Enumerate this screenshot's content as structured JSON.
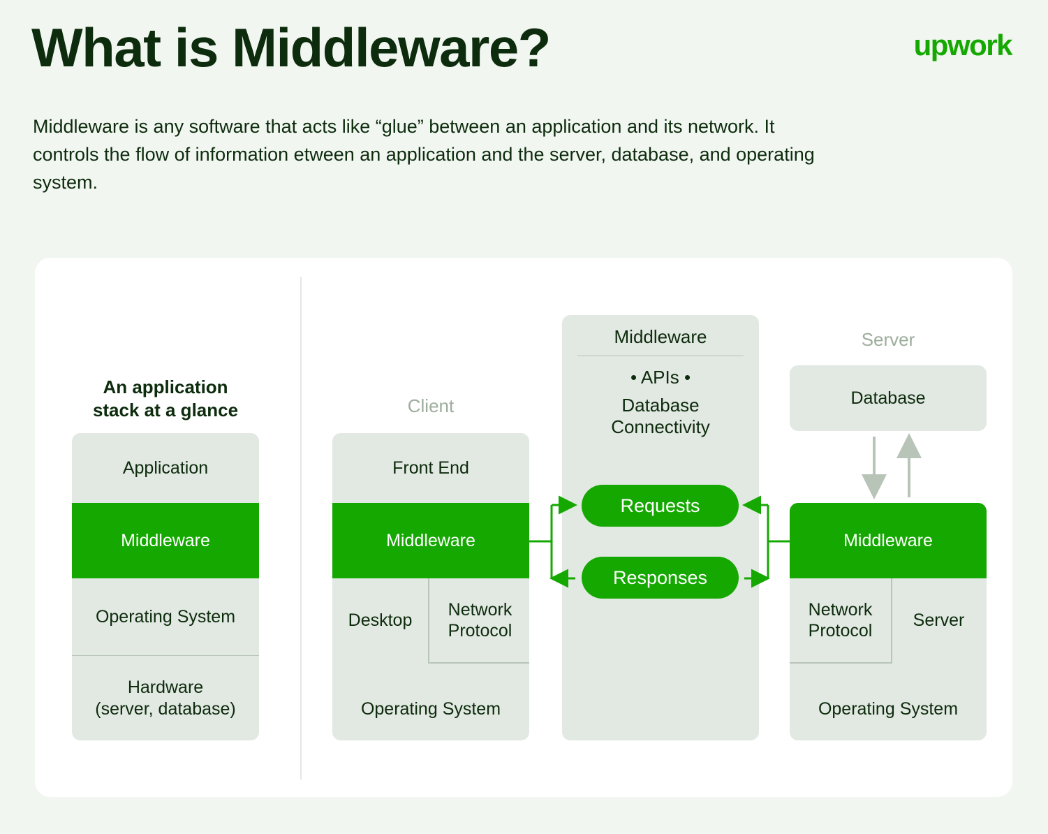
{
  "header": {
    "title": "What is Middleware?",
    "logo": "upwork",
    "intro": "Middleware is any software that acts like “glue” between an application and its network. It controls the flow of information etween an application and the server, database, and operating system."
  },
  "colors": {
    "background": "#f1f6f1",
    "card": "#ffffff",
    "green": "#14a800",
    "box_gray": "#e2e8e2",
    "muted_label": "#9dad9c",
    "text_dark": "#0d2b0d",
    "rule": "#b9c5b8",
    "arrow_gray": "#b8c4b8"
  },
  "columns": {
    "stack": {
      "heading": "An application\nstack at a glance",
      "heading_line1": "An application",
      "heading_line2": "stack at a glance",
      "rows": [
        {
          "label": "Application",
          "highlight": false
        },
        {
          "label": "Middleware",
          "highlight": true
        },
        {
          "label": "Operating System",
          "highlight": false
        },
        {
          "label": "Hardware\n(server, database)",
          "highlight": false
        }
      ],
      "hardware_line1": "Hardware",
      "hardware_line2": "(server, database)"
    },
    "client": {
      "heading": "Client",
      "rows": [
        {
          "label": "Front End",
          "highlight": false
        },
        {
          "label": "Middleware",
          "highlight": true
        },
        {
          "label": "Operating System",
          "highlight": false
        }
      ],
      "desktop": "Desktop",
      "network_protocol_line1": "Network",
      "network_protocol_line2": "Protocol"
    },
    "middleware": {
      "heading": "Middleware",
      "apis": "• APIs •",
      "database_line1": "Database",
      "database_line2": "Connectivity",
      "pills": [
        {
          "label": "Requests"
        },
        {
          "label": "Responses"
        }
      ]
    },
    "server": {
      "heading": "Server",
      "database": "Database",
      "rows": [
        {
          "label": "Middleware",
          "highlight": true
        },
        {
          "label": "Operating System",
          "highlight": false
        }
      ],
      "network_protocol_line1": "Network",
      "network_protocol_line2": "Protocol",
      "server_cell": "Server"
    }
  }
}
